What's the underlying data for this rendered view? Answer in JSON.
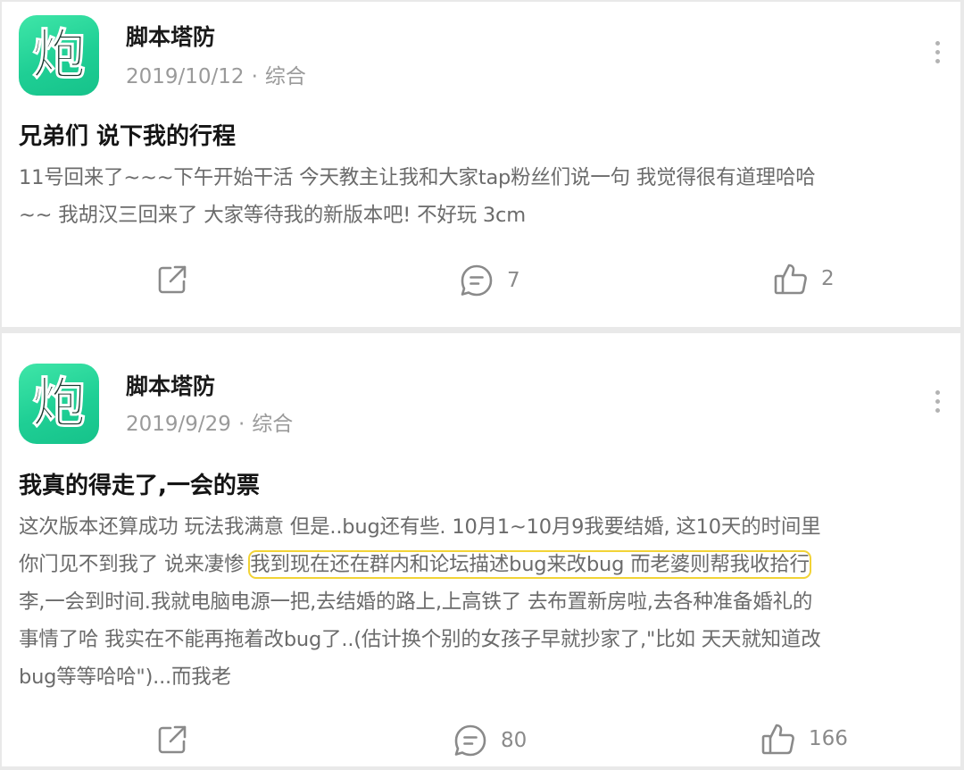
{
  "posts": [
    {
      "author": "脚本塔防",
      "date": "2019/10/12",
      "separator": "·",
      "category": "综合",
      "title": "兄弟们 说下我的行程",
      "body_lines": [
        "11号回来了~~~下午开始干活 今天教主让我和大家tap粉丝们说一句 我觉得很有道理哈哈",
        "~~ 我胡汉三回来了  大家等待我的新版本吧! 不好玩 3cm"
      ],
      "comments": "7",
      "likes": "2"
    },
    {
      "author": "脚本塔防",
      "date": "2019/9/29",
      "separator": "·",
      "category": "综合",
      "title": "我真的得走了,一会的票",
      "body_line1": "这次版本还算成功 玩法我满意 但是..bug还有些. 10月1~10月9我要结婚, 这10天的时间里",
      "body_line2_pre": "你门见不到我了 说来凄惨 ",
      "body_line2_highlight": "我到现在还在群内和论坛描述bug来改bug 而老婆则帮我收拾行",
      "body_line3": "李,一会到时间.我就电脑电源一把,去结婚的路上,上高铁了 去布置新房啦,去各种准备婚礼的",
      "body_line4": "事情了哈 我实在不能再拖着改bug了..(估计换个别的女孩子早就抄家了,\"比如 天天就知道改",
      "body_line5": "bug等等哈哈\")...而我老",
      "comments": "80",
      "likes": "166"
    }
  ],
  "avatar_char": "炮",
  "colors": {
    "avatar_green": "#1fcf95",
    "highlight": "#f2d336"
  },
  "icons": [
    "share-icon",
    "comment-icon",
    "like-icon",
    "more-icon"
  ]
}
